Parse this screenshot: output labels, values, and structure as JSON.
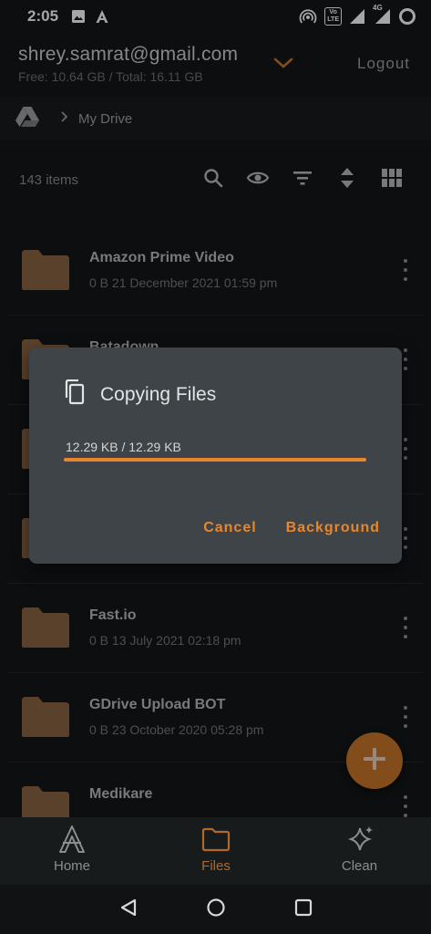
{
  "status_bar": {
    "time": "2:05",
    "network_label": "4G"
  },
  "account": {
    "email": "shrey.samrat@gmail.com",
    "storage": "Free: 10.64 GB / Total: 16.11 GB",
    "logout_label": "Logout"
  },
  "breadcrumb": {
    "current": "My Drive"
  },
  "toolbar": {
    "item_count": "143 items"
  },
  "files": [
    {
      "name": "Amazon Prime Video",
      "meta": "0 B 21 December 2021 01:59 pm"
    },
    {
      "name": "Batadown",
      "meta": ""
    },
    {
      "name": "",
      "meta": ""
    },
    {
      "name": "",
      "meta": ""
    },
    {
      "name": "Fast.io",
      "meta": "0 B 13 July 2021 02:18 pm"
    },
    {
      "name": "GDrive Upload BOT",
      "meta": "0 B 23 October 2020 05:28 pm"
    },
    {
      "name": "Medikare",
      "meta": ""
    }
  ],
  "dialog": {
    "title": "Copying Files",
    "progress_text": "12.29 KB / 12.29 KB",
    "progress_fraction": 1.0,
    "cancel_label": "Cancel",
    "background_label": "Background"
  },
  "bottom_nav": {
    "home_label": "Home",
    "files_label": "Files",
    "clean_label": "Clean",
    "active": "Files"
  },
  "colors": {
    "accent": "#e8862c",
    "folder": "#8a6444",
    "background": "#141617",
    "dialog": "#3e4447"
  }
}
